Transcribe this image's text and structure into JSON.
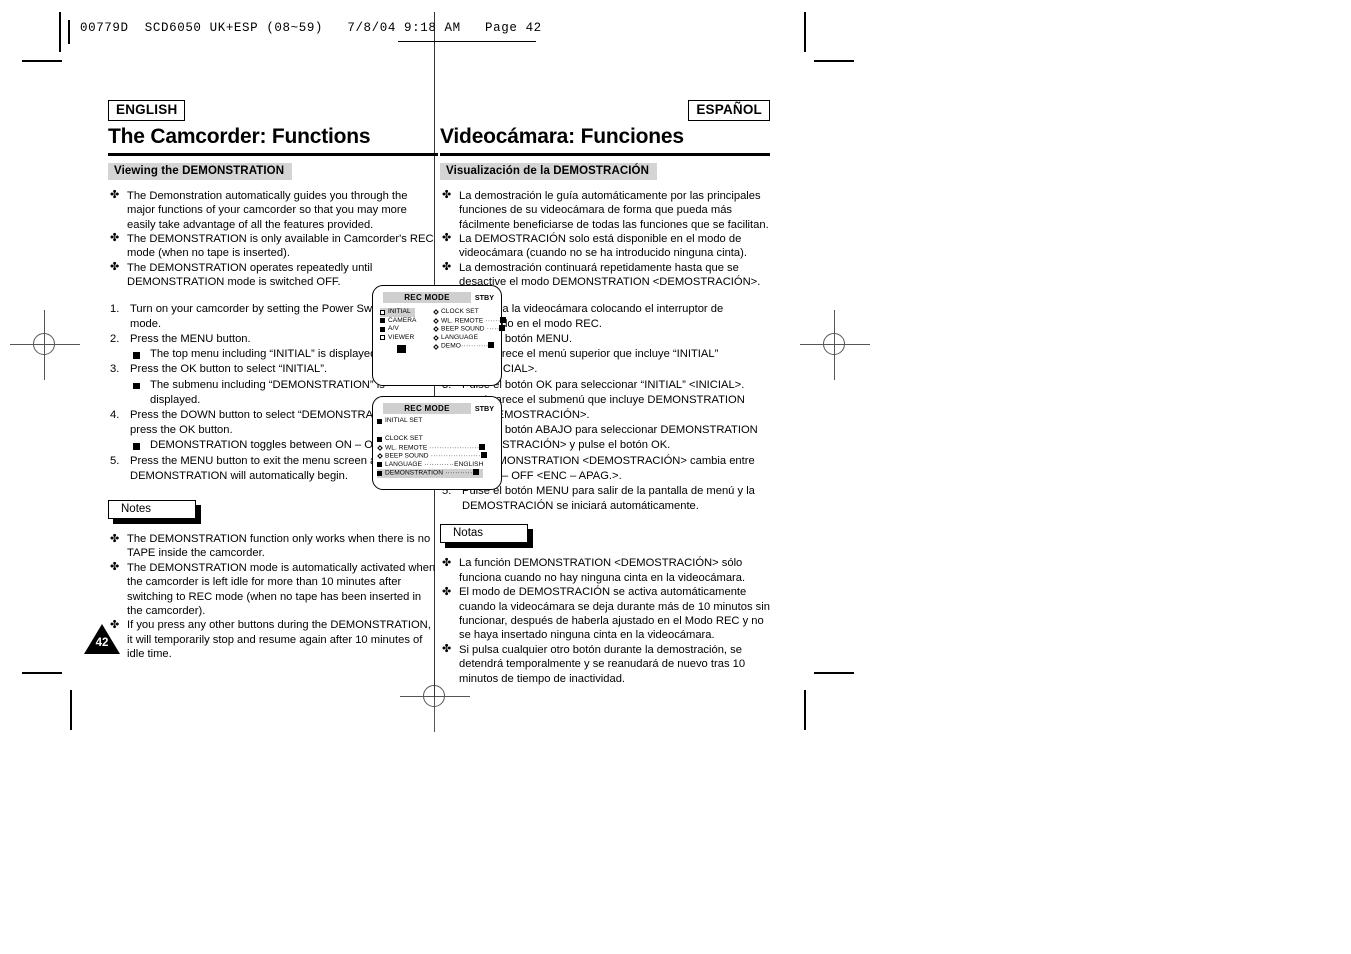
{
  "film_header": {
    "text": "00779D  SCD6050 UK+ESP (08~59)   7/8/04 9:18 AM   Page 42"
  },
  "page_number": "42",
  "english": {
    "lang_badge": "ENGLISH",
    "chapter_title": "The Camcorder: Functions",
    "section_bar": "Viewing the DEMONSTRATION",
    "intro_bullets": [
      "The Demonstration automatically guides you through the major functions of your camcorder so that you may more easily take advantage of all the features provided.",
      "The DEMONSTRATION is only available in Camcorder's REC mode (when no tape is inserted).",
      "The DEMONSTRATION operates repeatedly until DEMONSTRATION mode is switched OFF."
    ],
    "steps": [
      {
        "text": "Turn on your camcorder by setting the Power Switch to REC mode.",
        "subnotes": []
      },
      {
        "text": "Press the MENU button.",
        "subnotes": [
          "The top menu including “INITIAL” is displayed."
        ]
      },
      {
        "text": "Press the OK button to select “INITIAL”.",
        "subnotes": [
          "The submenu including “DEMONSTRATION” is displayed."
        ]
      },
      {
        "text": "Press the DOWN button to select “DEMONSTRATION”, then press the OK button.",
        "subnotes": [
          "DEMONSTRATION toggles between ON – OFF."
        ]
      },
      {
        "text": "Press the MENU button to exit the menu screen and the DEMONSTRATION will automatically begin.",
        "subnotes": []
      }
    ],
    "notes_label": "Notes",
    "notes": [
      "The DEMONSTRATION function only works when there is no TAPE inside the camcorder.",
      "The DEMONSTRATION mode is automatically activated when the camcorder is left idle for more than 10 minutes after switching to REC mode (when no tape has been inserted in the camcorder).",
      "If you press any other buttons during the DEMONSTRATION, it will temporarily stop and resume again after 10 minutes of idle time."
    ]
  },
  "spanish": {
    "lang_badge": "ESPAÑOL",
    "chapter_title": "Videocámara: Funciones",
    "section_bar": "Visualización de la DEMOSTRACIÓN",
    "intro_bullets": [
      "La demostración le guía automáticamente por las principales funciones de su videocámara de forma que pueda más fácilmente beneficiarse de todas las funciones que se facilitan.",
      "La DEMOSTRACIÓN solo está disponible en el modo de videocámara (cuando no se ha introducido ninguna cinta).",
      "La demostración continuará repetidamente hasta que se desactive el modo DEMONSTRATION <DEMOSTRACIÓN>."
    ],
    "steps": [
      {
        "text": "Encienda la videocámara colocando el interruptor de encendido en el modo REC.",
        "subnotes": []
      },
      {
        "text": "Pulse el botón MENU.",
        "subnotes": [
          "Aparece el menú superior que incluye “INITIAL” <INICIAL>."
        ]
      },
      {
        "text": "Pulse el botón OK para seleccionar “INITIAL” <INICIAL>.",
        "subnotes": [
          "Aparece el submenú que incluye DEMONSTRATION <DEMOSTRACIÓN>."
        ]
      },
      {
        "text": "Pulse el botón ABAJO para seleccionar DEMONSTRATION <DEMOSTRACIÓN> y pulse el botón OK.",
        "subnotes": [
          "DEMONSTRATION <DEMOSTRACIÓN> cambia entre ON – OFF <ENC – APAG.>."
        ]
      },
      {
        "text": "Pulse el botón MENU para salir de la pantalla de menú y la DEMOSTRACIÓN se iniciará automáticamente.",
        "subnotes": []
      }
    ],
    "notes_label": "Notas",
    "notes": [
      "La función DEMONSTRATION <DEMOSTRACIÓN> sólo funciona cuando no hay ninguna cinta en la videocámara.",
      "El modo de DEMOSTRACIÓN se activa automáticamente cuando la videocámara se deja durante más de 10 minutos sin funcionar, después de haberla ajustado en el Modo REC y no se haya insertado ninguna cinta en la videocámara.",
      "Si pulsa cualquier otro botón durante la demostración, se detendrá temporalmente y se reanudará de nuevo tras 10 minutos de tiempo de inactividad."
    ]
  },
  "lcd_screens": [
    {
      "title": "REC MODE",
      "status": "STBY",
      "left_items": [
        "INITIAL",
        "CAMERA",
        "A/V",
        "VIEWER"
      ],
      "right_items": [
        {
          "label": "CLOCK SET",
          "value": ""
        },
        {
          "label": "WL. REMOTE",
          "value": "square"
        },
        {
          "label": "BEEP SOUND",
          "value": "square"
        },
        {
          "label": "LANGUAGE",
          "value": ""
        },
        {
          "label": "DEMO",
          "value": "square"
        }
      ]
    },
    {
      "title": "REC MODE",
      "status": "STBY",
      "header_item": "INITIAL SET",
      "rows": [
        {
          "label": "CLOCK SET",
          "value": ""
        },
        {
          "label": "WL. REMOTE",
          "value": "square"
        },
        {
          "label": "BEEP SOUND",
          "value": "square"
        },
        {
          "label": "LANGUAGE",
          "value": "ENGLISH"
        },
        {
          "label": "DEMONSTRATION",
          "value": "square",
          "highlight": true
        }
      ]
    }
  ]
}
